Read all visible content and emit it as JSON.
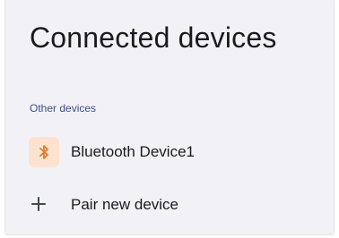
{
  "page": {
    "title": "Connected devices"
  },
  "sections": {
    "other_devices": {
      "header": "Other devices",
      "devices": [
        {
          "name": "Bluetooth Device1",
          "icon": "bluetooth-icon"
        }
      ]
    }
  },
  "actions": {
    "pair_new_device": {
      "label": "Pair new device",
      "icon": "plus-icon"
    }
  },
  "colors": {
    "background": "#f2f1f6",
    "accent_header": "#3b4f8a",
    "device_icon_bg": "#fde3cf",
    "device_icon_fg": "#e07a2e",
    "text_primary": "#1b1b1f"
  }
}
